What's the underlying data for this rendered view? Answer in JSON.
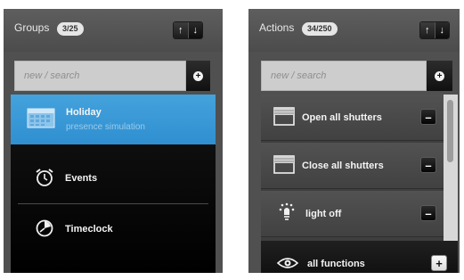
{
  "groups": {
    "title": "Groups",
    "count": "3/25",
    "sort_up": "↑",
    "sort_down": "↓",
    "search_placeholder": "new / search",
    "add_symbol": "+",
    "items": [
      {
        "label": "Holiday",
        "sublabel": "presence simulation",
        "icon": "calendar-icon",
        "selected": true
      },
      {
        "label": "Events",
        "icon": "alarm-clock-icon",
        "selected": false
      },
      {
        "label": "Timeclock",
        "icon": "clock-icon",
        "selected": false
      }
    ]
  },
  "actions": {
    "title": "Actions",
    "count": "34/250",
    "sort_up": "↑",
    "sort_down": "↓",
    "search_placeholder": "new / search",
    "add_symbol": "+",
    "items": [
      {
        "label": "Open all shutters",
        "icon": "shutter-icon",
        "button": "–"
      },
      {
        "label": "Close all shutters",
        "icon": "shutter-icon",
        "button": "–"
      },
      {
        "label": "light off",
        "icon": "light-icon",
        "button": "–"
      },
      {
        "label": "all functions",
        "icon": "eye-icon",
        "button": "+"
      }
    ]
  },
  "colors": {
    "selected_blue": "#3a98d6",
    "panel_bg": "#505050"
  }
}
